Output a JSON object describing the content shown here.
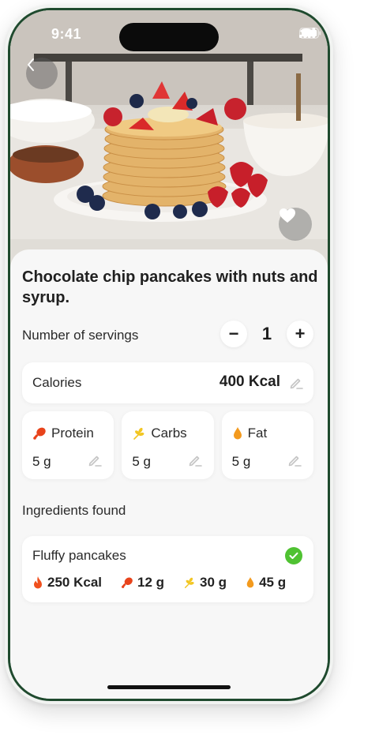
{
  "status_bar": {
    "time": "9:41"
  },
  "recipe": {
    "title": "Chocolate chip pancakes with nuts and syrup."
  },
  "servings": {
    "label": "Number of servings",
    "value": "1",
    "decrement": "−",
    "increment": "+"
  },
  "calories": {
    "label": "Calories",
    "value": "400 Kcal"
  },
  "macros": [
    {
      "name": "Protein",
      "value": "5 g",
      "icon": "drumstick-icon",
      "color": "#e8431b"
    },
    {
      "name": "Carbs",
      "value": "5 g",
      "icon": "wheat-icon",
      "color": "#f2c623"
    },
    {
      "name": "Fat",
      "value": "5 g",
      "icon": "droplet-icon",
      "color": "#f39a1e"
    }
  ],
  "ingredients": {
    "section_label": "Ingredients found",
    "items": [
      {
        "name": "Fluffy pancakes",
        "found": true,
        "calories": "250 Kcal",
        "protein": "12 g",
        "carbs": "30 g",
        "fat": "45 g"
      }
    ]
  },
  "colors": {
    "frame_accent": "#1f4a2e",
    "check_green": "#4fc232",
    "protein": "#e8431b",
    "carbs": "#f2c623",
    "fat": "#f39a1e",
    "calories": "#f0501e"
  }
}
